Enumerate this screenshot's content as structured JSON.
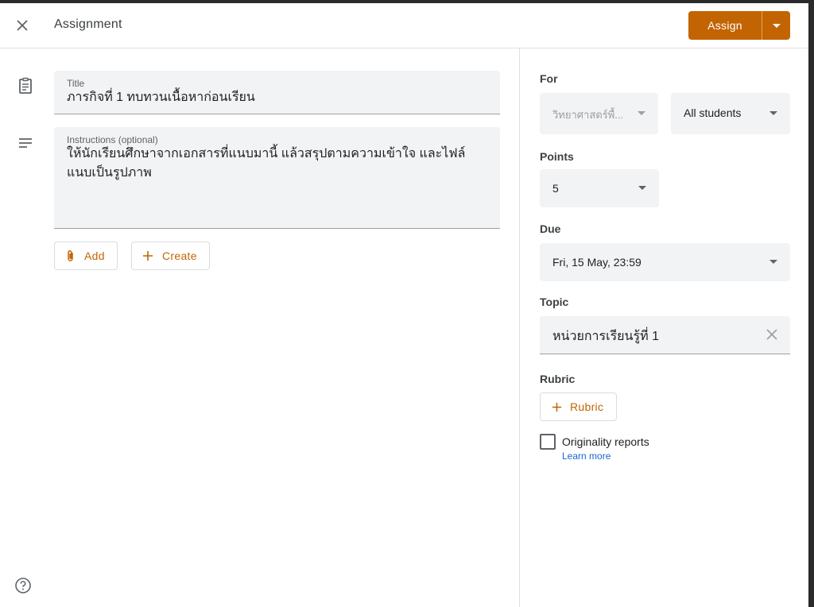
{
  "header": {
    "title": "Assignment",
    "assign_label": "Assign"
  },
  "main": {
    "title_field": {
      "label": "Title",
      "value": "ภารกิจที่ 1 ทบทวนเนื้อหาก่อนเรียน"
    },
    "instructions_field": {
      "label": "Instructions (optional)",
      "value": "ให้นักเรียนศึกษาจากเอกสารที่แนบมานี้ แล้วสรุปตามความเข้าใจ และไฟล์แนบเป็นรูปภาพ"
    },
    "add_label": "Add",
    "create_label": "Create"
  },
  "side": {
    "for_label": "For",
    "class_value": "วิทยาศาสตร์พื้...",
    "students_value": "All students",
    "points_label": "Points",
    "points_value": "5",
    "due_label": "Due",
    "due_value": "Fri, 15 May, 23:59",
    "topic_label": "Topic",
    "topic_value": "หน่วยการเรียนรู้ที่ 1",
    "rubric_label": "Rubric",
    "rubric_button": "Rubric",
    "originality_label": "Originality reports",
    "learn_more": "Learn more"
  },
  "colors": {
    "accent": "#c26401",
    "link": "#1967d2"
  },
  "icons": [
    "close-icon",
    "chevron-down-icon",
    "assignment-icon",
    "notes-icon",
    "paperclip-icon",
    "plus-icon",
    "clear-icon",
    "help-icon"
  ]
}
